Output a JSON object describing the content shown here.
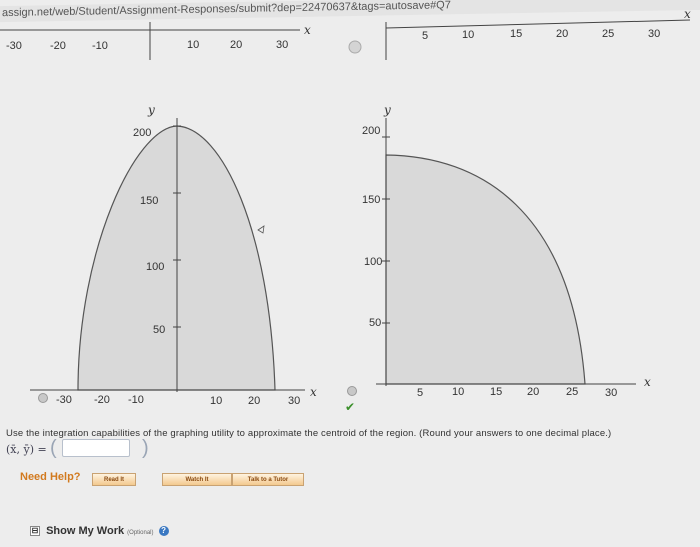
{
  "browser": {
    "url": "assign.net/web/Student/Assignment-Responses/submit?dep=22470637&tags=autosave#Q7"
  },
  "top_axes": {
    "left_labels": [
      "-30",
      "-20",
      "-10",
      "10",
      "20",
      "30"
    ],
    "left_axis_label": "x",
    "right_labels": [
      "5",
      "10",
      "15",
      "20",
      "25",
      "30"
    ],
    "right_axis_label": "x"
  },
  "graphs": {
    "left": {
      "y_label": "y",
      "y_ticks": [
        "200",
        "150",
        "100",
        "50"
      ],
      "x_ticks": [
        "-30",
        "-20",
        "-10",
        "10",
        "20",
        "30"
      ],
      "x_label": "x",
      "region_color": "#d9d9d9",
      "selected": false
    },
    "right": {
      "y_label": "y",
      "y_ticks": [
        "200",
        "150",
        "100",
        "50"
      ],
      "x_ticks": [
        "5",
        "10",
        "15",
        "20",
        "25",
        "30"
      ],
      "x_label": "x",
      "region_color": "#d9d9d9",
      "selected": true,
      "correct_mark": "✔"
    }
  },
  "question": {
    "instruction": "Use the integration capabilities of the graphing utility to approximate the centroid of the region. (Round your answers to one decimal place.)",
    "answer_label": "(x̄, ȳ) =",
    "answer_value": "",
    "paren_open": "(",
    "paren_close": ")"
  },
  "help": {
    "need_help": "Need Help?",
    "read_it": "Read It",
    "watch_it": "Watch It",
    "talk_to_tutor": "Talk to a Tutor"
  },
  "show_work": {
    "toggle": "⊟",
    "label": "Show My Work",
    "optional": "(Optional)",
    "help_icon": "?"
  },
  "colors": {
    "accent_orange": "#d27a1f",
    "correct_green": "#3a8f2a",
    "region_fill": "#d9d9d9"
  }
}
